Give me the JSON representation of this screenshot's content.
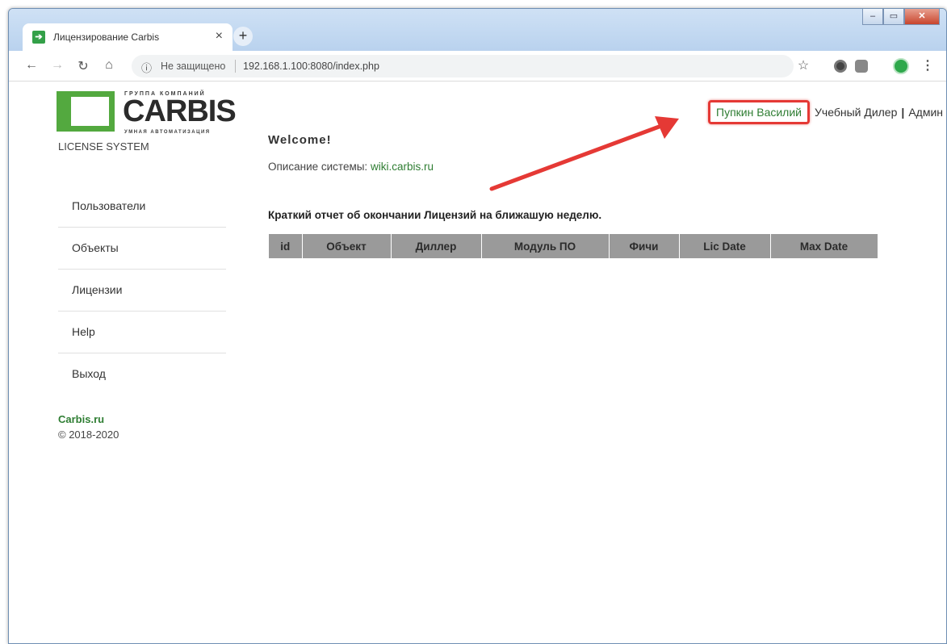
{
  "browser": {
    "tab_title": "Лицензирование Carbis",
    "tab_close": "×",
    "new_tab": "+",
    "security_label": "Не защищено",
    "url": "192.168.1.100:8080/index.php"
  },
  "logo": {
    "group_text": "ГРУППА КОМПАНИЙ",
    "name": "CARBIS",
    "tagline": "УМНАЯ АВТОМАТИЗАЦИЯ",
    "system_label": "LICENSE SYSTEM"
  },
  "sidebar": {
    "items": [
      {
        "label": "Пользователи"
      },
      {
        "label": "Объекты"
      },
      {
        "label": "Лицензии"
      },
      {
        "label": "Help"
      },
      {
        "label": "Выход"
      }
    ]
  },
  "footer": {
    "site": "Carbis.ru",
    "copyright": "© 2018-2020"
  },
  "header_user": {
    "name": "Пупкин Василий",
    "dealer": "Учебный Дилер",
    "separator": "|",
    "role": "Админ"
  },
  "main": {
    "welcome": "Welcome!",
    "description_label": "Описание системы:",
    "description_link": "wiki.carbis.ru",
    "report_title": "Краткий отчет об окончании Лицензий на ближашую неделю.",
    "table_headers": [
      "id",
      "Объект",
      "Диллер",
      "Модуль ПО",
      "Фичи",
      "Lic Date",
      "Max Date"
    ]
  },
  "colors": {
    "brand_green": "#53a93f",
    "link_green": "#2e7d32",
    "highlight_red": "#e53935",
    "table_header": "#9a9a9a"
  }
}
